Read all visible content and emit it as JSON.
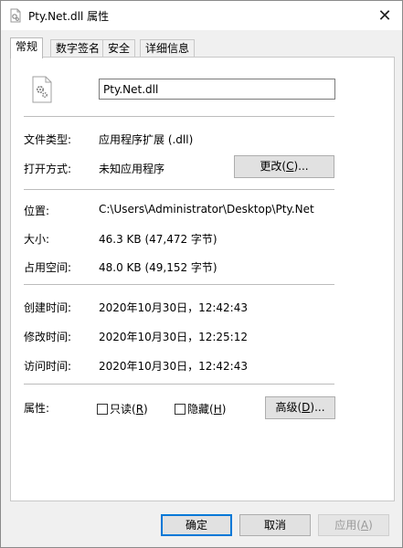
{
  "window": {
    "title": "Pty.Net.dll 属性",
    "close_symbol": "✕"
  },
  "tabs": [
    {
      "label": "常规",
      "active": true
    },
    {
      "label": "数字签名",
      "active": false
    },
    {
      "label": "安全",
      "active": false
    },
    {
      "label": "详细信息",
      "active": false
    }
  ],
  "general": {
    "file_name": "Pty.Net.dll",
    "file_type_label": "文件类型:",
    "file_type_value": "应用程序扩展 (.dll)",
    "opens_with_label": "打开方式:",
    "opens_with_value": "未知应用程序",
    "change_button": {
      "text": "更改",
      "key": "C",
      "suffix": "..."
    },
    "location_label": "位置:",
    "location_value": "C:\\Users\\Administrator\\Desktop\\Pty.Net",
    "size_label": "大小:",
    "size_value": "46.3 KB (47,472 字节)",
    "size_on_disk_label": "占用空间:",
    "size_on_disk_value": "48.0 KB (49,152 字节)",
    "created_label": "创建时间:",
    "created_value": "2020年10月30日，12:42:43",
    "modified_label": "修改时间:",
    "modified_value": "2020年10月30日，12:25:12",
    "accessed_label": "访问时间:",
    "accessed_value": "2020年10月30日，12:42:43",
    "attributes_label": "属性:",
    "readonly": {
      "text": "只读",
      "key": "R",
      "checked": false
    },
    "hidden": {
      "text": "隐藏",
      "key": "H",
      "checked": false
    },
    "advanced_button": {
      "text": "高级",
      "key": "D",
      "suffix": "..."
    }
  },
  "footer": {
    "ok_label": "确定",
    "cancel_label": "取消",
    "apply": {
      "text": "应用",
      "key": "A",
      "enabled": false
    }
  },
  "icons": {
    "title_icon": "dll-file-icon",
    "file_icon": "dll-gear-file-icon"
  }
}
